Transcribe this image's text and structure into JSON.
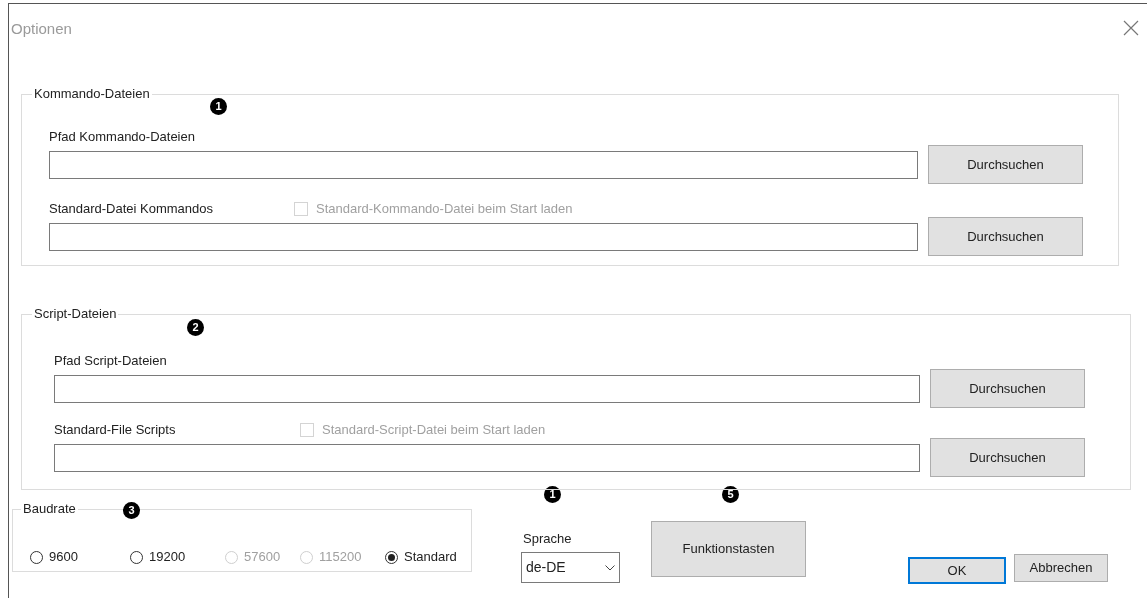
{
  "window": {
    "title": "Optionen"
  },
  "groups": [
    {
      "legend": "Kommando-Dateien",
      "badge": "1",
      "rows": [
        {
          "label": "Pfad Kommando-Dateien",
          "button": "Durchsuchen"
        },
        {
          "label": "Standard-Datei Kommandos",
          "checkbox": {
            "label": "Standard-Kommando-Datei beim Start laden",
            "checked": false,
            "disabled": true
          },
          "button": "Durchsuchen"
        }
      ]
    },
    {
      "legend": "Script-Dateien",
      "badge": "2",
      "rows": [
        {
          "label": "Pfad Script-Dateien",
          "button": "Durchsuchen"
        },
        {
          "label": "Standard-File Scripts",
          "checkbox": {
            "label": "Standard-Script-Datei beim Start laden",
            "checked": false,
            "disabled": true
          },
          "button": "Durchsuchen"
        }
      ]
    }
  ],
  "baudrate": {
    "legend": "Baudrate",
    "badge": "3",
    "options": [
      {
        "label": "9600",
        "selected": false,
        "disabled": false
      },
      {
        "label": "19200",
        "selected": false,
        "disabled": false
      },
      {
        "label": "57600",
        "selected": false,
        "disabled": true
      },
      {
        "label": "115200",
        "selected": false,
        "disabled": true
      },
      {
        "label": "Standard",
        "selected": true,
        "disabled": false
      }
    ]
  },
  "language": {
    "badge": "1",
    "label": "Sprache",
    "value": "de-DE"
  },
  "function_keys": {
    "badge": "5",
    "label": "Funktionstasten"
  },
  "buttons": [
    {
      "label": "OK",
      "default": true
    },
    {
      "label": "Abbrechen",
      "default": false
    }
  ]
}
